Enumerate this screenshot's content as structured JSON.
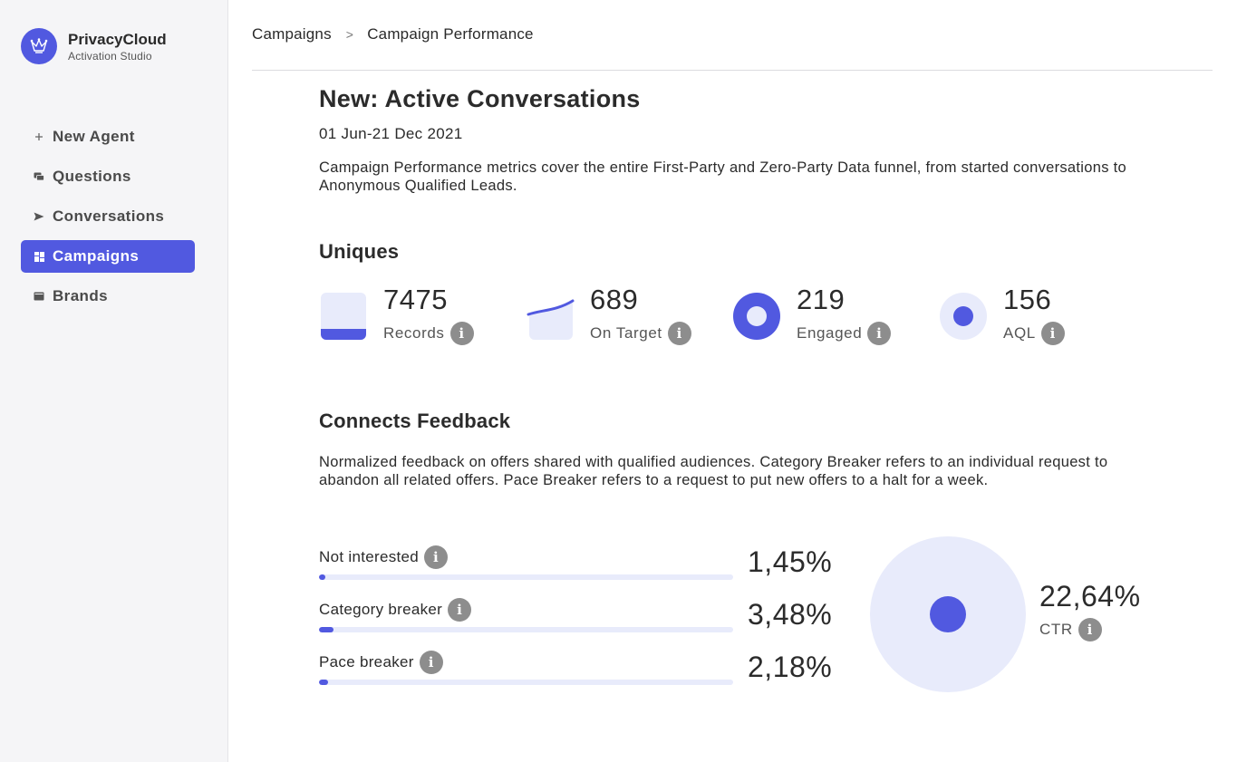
{
  "app": {
    "name": "PrivacyCloud",
    "subtitle": "Activation Studio",
    "accent_color": "#5159e0",
    "logo_icon": "crown-icon"
  },
  "sidebar": {
    "items": [
      {
        "label": "New Agent",
        "icon": "plus-icon",
        "active": false
      },
      {
        "label": "Questions",
        "icon": "chat-icon",
        "active": false
      },
      {
        "label": "Conversations",
        "icon": "send-icon",
        "active": false
      },
      {
        "label": "Campaigns",
        "icon": "grid-icon",
        "active": true
      },
      {
        "label": "Brands",
        "icon": "wallet-icon",
        "active": false
      }
    ]
  },
  "breadcrumb": {
    "items": [
      "Campaigns",
      "Campaign Performance"
    ],
    "separator": ">"
  },
  "page": {
    "title": "New: Active Conversations",
    "date_range": "01 Jun-21 Dec 2021",
    "description": "Campaign Performance metrics cover the entire First-Party and Zero-Party Data funnel, from started conversations to Anonymous Qualified Leads."
  },
  "uniques": {
    "title": "Uniques",
    "stats": [
      {
        "value": "7475",
        "label": "Records",
        "icon": "records-icon"
      },
      {
        "value": "689",
        "label": "On Target",
        "icon": "trend-icon"
      },
      {
        "value": "219",
        "label": "Engaged",
        "icon": "ring-icon"
      },
      {
        "value": "156",
        "label": "AQL",
        "icon": "dot-icon"
      }
    ]
  },
  "feedback": {
    "title": "Connects Feedback",
    "description": "Normalized feedback on offers shared with qualified audiences. Category Breaker refers to an individual request to abandon all related offers. Pace Breaker refers to a request to put new offers to a halt for a week.",
    "bars": [
      {
        "label": "Not interested",
        "value": "1,45%",
        "fraction": 0.0145
      },
      {
        "label": "Category breaker",
        "value": "3,48%",
        "fraction": 0.0348
      },
      {
        "label": "Pace breaker",
        "value": "2,18%",
        "fraction": 0.0218
      }
    ],
    "ctr": {
      "value": "22,64%",
      "label": "CTR"
    }
  },
  "info_glyph": "i"
}
